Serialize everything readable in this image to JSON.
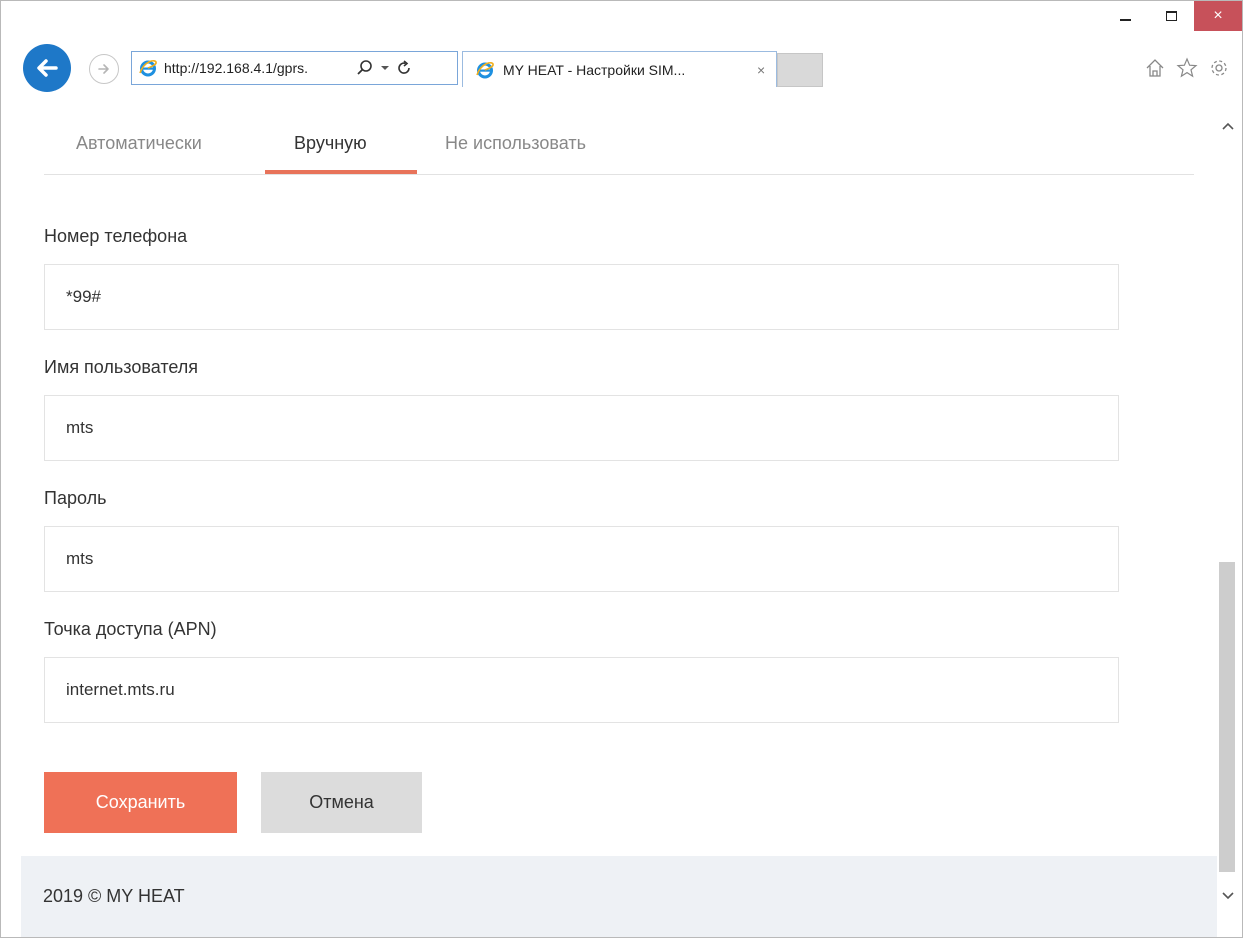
{
  "browser": {
    "address_url": "http://192.168.4.1/gprs.",
    "tab_title": "MY HEAT - Настройки SIM...",
    "tab_close": "×",
    "close_glyph": "×"
  },
  "tabs": [
    {
      "label": "Автоматически",
      "active": false
    },
    {
      "label": "Вручную",
      "active": true
    },
    {
      "label": "Не использовать",
      "active": false
    }
  ],
  "form": {
    "phone_label": "Номер телефона",
    "phone_value": "*99#",
    "user_label": "Имя пользователя",
    "user_value": "mts",
    "password_label": "Пароль",
    "password_value": "mts",
    "apn_label": "Точка доступа (APN)",
    "apn_value": "internet.mts.ru"
  },
  "buttons": {
    "save": "Сохранить",
    "cancel": "Отмена"
  },
  "footer": {
    "text": "2019 © MY HEAT"
  },
  "colors": {
    "accent": "#ef7157",
    "tab_underline": "#e8735a",
    "cancel_bg": "#dcdcdc",
    "footer_bg": "#eef1f5",
    "ie_blue": "#1e78c8"
  }
}
